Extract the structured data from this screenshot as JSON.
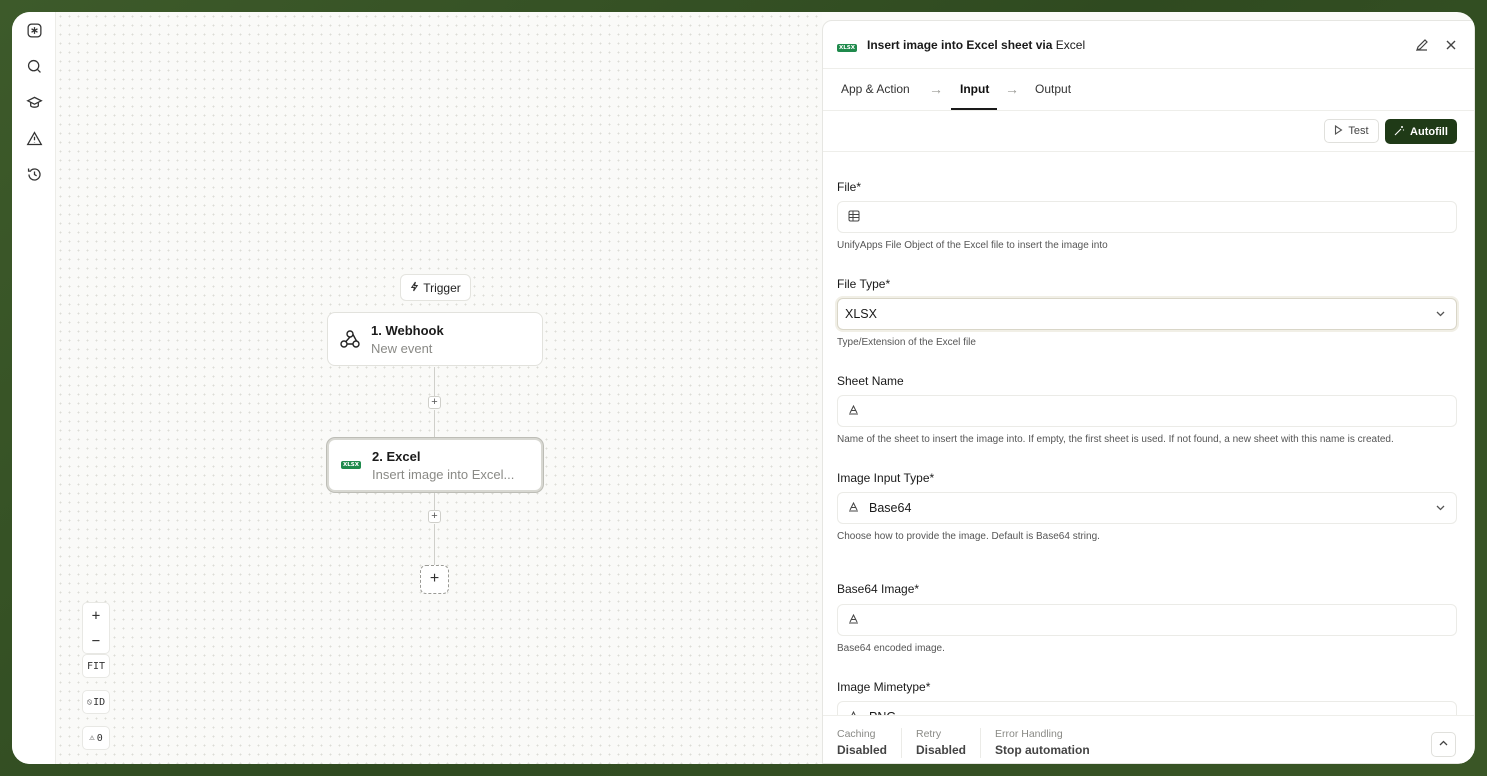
{
  "canvas": {
    "trigger_label": "Trigger",
    "nodes": [
      {
        "title": "1. Webhook",
        "subtitle": "New event"
      },
      {
        "title": "2. Excel",
        "subtitle": "Insert image into Excel..."
      }
    ],
    "plus_symbol": "+",
    "zoom_in": "+",
    "zoom_out": "−",
    "fit": "FIT",
    "id_toggle": "ID",
    "warn_count": "0",
    "xlsx_badge": "XLSX"
  },
  "panel": {
    "title": "Insert image into Excel sheet via",
    "title_app": "Excel",
    "tabs": [
      {
        "label": "App & Action"
      },
      {
        "label": "Input"
      },
      {
        "label": "Output"
      }
    ],
    "test_label": "Test",
    "autofill_label": "Autofill",
    "fields": [
      {
        "label": "File*",
        "value": "",
        "help": "UnifyApps File Object of the Excel file to insert the image into"
      },
      {
        "label": "File Type*",
        "value": "XLSX",
        "help": "Type/Extension of the Excel file"
      },
      {
        "label": "Sheet Name",
        "value": "",
        "help": "Name of the sheet to insert the image into. If empty, the first sheet is used. If not found, a new sheet with this name is created."
      },
      {
        "label": "Image Input Type*",
        "value": "Base64",
        "help": "Choose how to provide the image. Default is Base64 string."
      },
      {
        "label": "Base64 Image*",
        "value": "",
        "help": "Base64 encoded image."
      },
      {
        "label": "Image Mimetype*",
        "value": "PNG",
        "help": ""
      }
    ],
    "footer": [
      {
        "label": "Caching",
        "value": "Disabled"
      },
      {
        "label": "Retry",
        "value": "Disabled"
      },
      {
        "label": "Error Handling",
        "value": "Stop automation"
      }
    ]
  },
  "colors": {
    "accent": "#1f3a17",
    "background": "#3d5a2a",
    "excel_green": "#1f8a4c"
  }
}
